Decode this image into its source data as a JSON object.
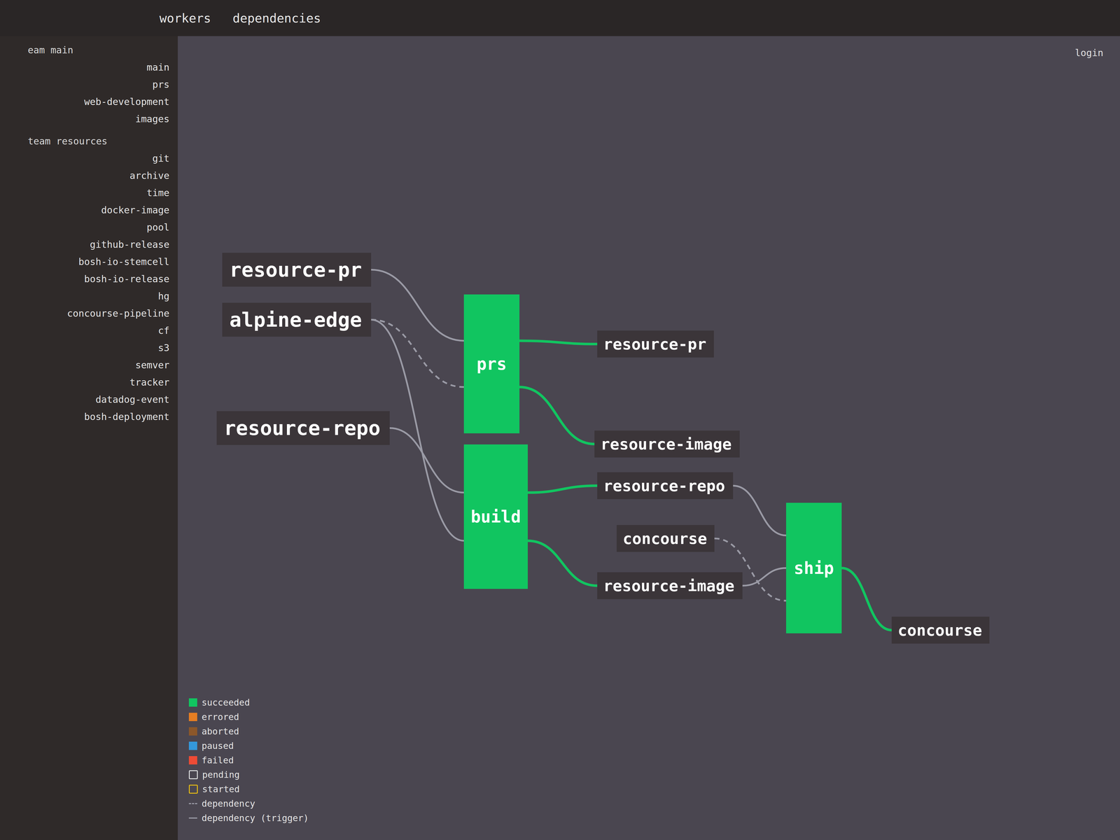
{
  "topbar": {
    "groups": [
      {
        "label": "workers",
        "selected": false
      },
      {
        "label": "dependencies",
        "selected": false
      }
    ],
    "login": "login"
  },
  "sidebar": {
    "teams": [
      {
        "name": "eam main",
        "pipelines": [
          "main",
          "prs",
          "web-development",
          "images"
        ]
      },
      {
        "name": "team resources",
        "pipelines": [
          "git",
          "archive",
          "time",
          "docker-image",
          "pool",
          "github-release",
          "bosh-io-stemcell",
          "bosh-io-release",
          "hg",
          "concourse-pipeline",
          "cf",
          "s3",
          "semver",
          "tracker",
          "datadog-event",
          "bosh-deployment"
        ]
      }
    ]
  },
  "diagram": {
    "columns": [
      [
        {
          "label": "resource-pr",
          "kind": "resource"
        },
        {
          "label": "alpine-edge",
          "kind": "resource"
        },
        {
          "label": "resource-repo",
          "kind": "resource"
        }
      ],
      [
        {
          "label": "prs",
          "kind": "job",
          "status": "succeeded"
        },
        {
          "label": "build",
          "kind": "job",
          "status": "succeeded"
        }
      ],
      [
        {
          "label": "resource-pr",
          "kind": "resource"
        },
        {
          "label": "resource-image",
          "kind": "resource"
        },
        {
          "label": "resource-repo",
          "kind": "resource"
        },
        {
          "label": "concourse",
          "kind": "resource"
        },
        {
          "label": "resource-image",
          "kind": "resource"
        }
      ],
      [
        {
          "label": "ship",
          "kind": "job",
          "status": "succeeded"
        }
      ],
      [
        {
          "label": "concourse",
          "kind": "resource"
        }
      ]
    ],
    "edges": [
      {
        "from": [
          0,
          0
        ],
        "to": [
          1,
          0
        ],
        "kind": "trigger"
      },
      {
        "from": [
          0,
          1
        ],
        "to": [
          1,
          0
        ],
        "kind": "dependency"
      },
      {
        "from": [
          0,
          2
        ],
        "to": [
          1,
          1
        ],
        "kind": "trigger"
      },
      {
        "from": [
          0,
          1
        ],
        "to": [
          1,
          1
        ],
        "kind": "trigger"
      },
      {
        "from": [
          1,
          0
        ],
        "to": [
          2,
          0
        ],
        "kind": "output"
      },
      {
        "from": [
          1,
          0
        ],
        "to": [
          2,
          1
        ],
        "kind": "output"
      },
      {
        "from": [
          1,
          1
        ],
        "to": [
          2,
          2
        ],
        "kind": "output"
      },
      {
        "from": [
          1,
          1
        ],
        "to": [
          2,
          4
        ],
        "kind": "output"
      },
      {
        "from": [
          2,
          2
        ],
        "to": [
          3,
          0
        ],
        "kind": "trigger"
      },
      {
        "from": [
          2,
          4
        ],
        "to": [
          3,
          0
        ],
        "kind": "trigger"
      },
      {
        "from": [
          2,
          3
        ],
        "to": [
          3,
          0
        ],
        "kind": "dependency"
      },
      {
        "from": [
          3,
          0
        ],
        "to": [
          4,
          0
        ],
        "kind": "output"
      }
    ]
  },
  "legend": [
    {
      "label": "succeeded",
      "kind": "square",
      "color": "#11c560"
    },
    {
      "label": "errored",
      "kind": "square",
      "color": "#e67e22"
    },
    {
      "label": "aborted",
      "kind": "square",
      "color": "#8b572a"
    },
    {
      "label": "paused",
      "kind": "square",
      "color": "#3498db"
    },
    {
      "label": "failed",
      "kind": "square",
      "color": "#ed4b35"
    },
    {
      "label": "pending",
      "kind": "outline",
      "color": "#e6e7e8"
    },
    {
      "label": "started",
      "kind": "outline",
      "color": "#f1c40f"
    },
    {
      "label": "dependency",
      "kind": "dashed",
      "color": "#9a9aa5"
    },
    {
      "label": "dependency (trigger)",
      "kind": "solid",
      "color": "#9a9aa5"
    }
  ]
}
